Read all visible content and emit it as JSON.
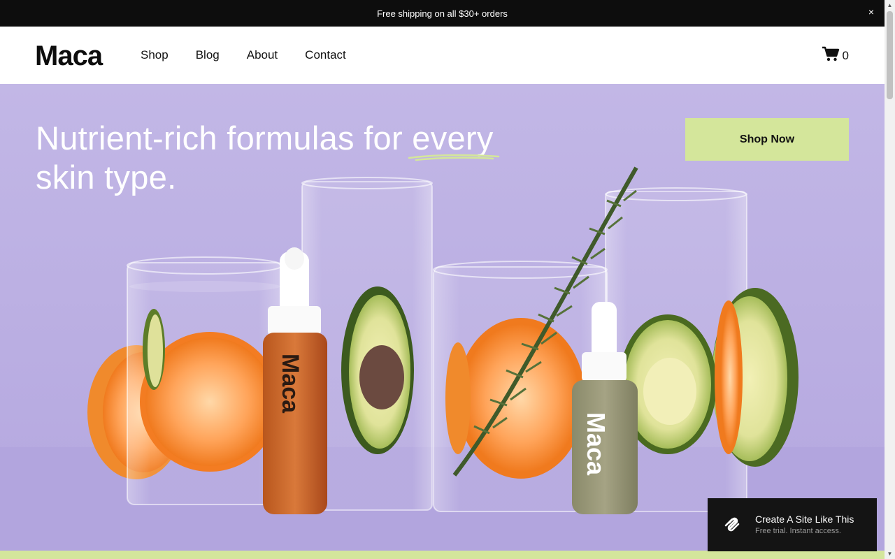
{
  "announcement": {
    "text": "Free shipping on all $30+ orders",
    "close_label": "×"
  },
  "header": {
    "logo": "Maca",
    "nav": [
      "Shop",
      "Blog",
      "About",
      "Contact"
    ],
    "cart_count": "0"
  },
  "hero": {
    "headline_part1": "Nutrient-rich formulas for ",
    "headline_underlined": "every",
    "headline_part2": "skin type.",
    "cta_label": "Shop Now",
    "bottle_brand": "Maca"
  },
  "promo": {
    "title": "Create A Site Like This",
    "subtitle": "Free trial. Instant access."
  },
  "colors": {
    "hero_bg": "#c3b8e6",
    "accent_green": "#d4e69b",
    "dark": "#0d0d0d"
  }
}
